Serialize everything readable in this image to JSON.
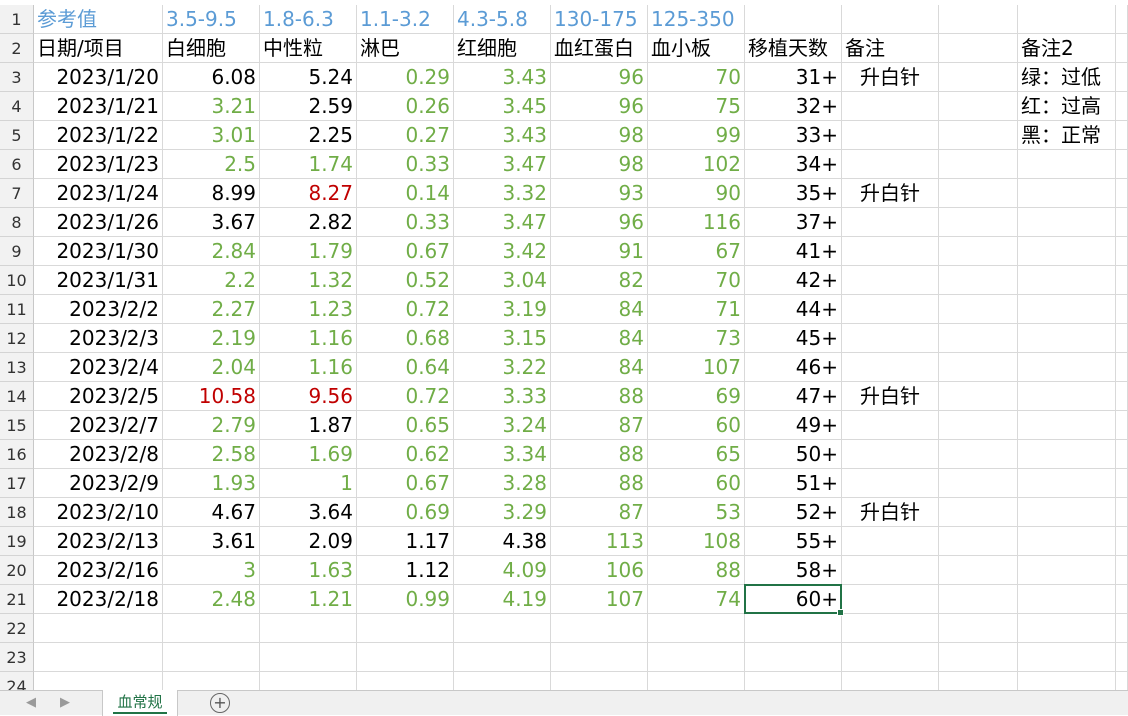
{
  "sheet": {
    "tab_name": "血常规",
    "add_sheet_icon": "plus-circle-icon",
    "selected_cell": "H21",
    "colors": {
      "ref": "#5b9bd5",
      "low": "#70ad47",
      "high": "#c00000",
      "normal": "#000000",
      "selection": "#217346"
    },
    "row_numbers": [
      "1",
      "2",
      "3",
      "4",
      "5",
      "6",
      "7",
      "8",
      "9",
      "10",
      "11",
      "12",
      "13",
      "14",
      "15",
      "16",
      "17",
      "18",
      "19",
      "20",
      "21",
      "22",
      "23",
      "24"
    ],
    "ref_row": [
      "参考值",
      "3.5-9.5",
      "1.8-6.3",
      "1.1-3.2",
      "4.3-5.8",
      "130-175",
      "125-350"
    ],
    "headers": [
      "日期/项目",
      "白细胞",
      "中性粒",
      "淋巴",
      "红细胞",
      "血红蛋白",
      "血小板",
      "移植天数",
      "备注"
    ],
    "side_notes": [
      "备注2",
      "绿：过低",
      "红：过高",
      "黑：正常"
    ],
    "rows": [
      {
        "date": "2023/1/20",
        "values": [
          "6.08",
          "5.24",
          "0.29",
          "3.43",
          "96",
          "70"
        ],
        "status": [
          "n",
          "n",
          "g",
          "g",
          "g",
          "g"
        ],
        "days": "31+",
        "note": "升白针"
      },
      {
        "date": "2023/1/21",
        "values": [
          "3.21",
          "2.59",
          "0.26",
          "3.45",
          "96",
          "75"
        ],
        "status": [
          "g",
          "n",
          "g",
          "g",
          "g",
          "g"
        ],
        "days": "32+",
        "note": ""
      },
      {
        "date": "2023/1/22",
        "values": [
          "3.01",
          "2.25",
          "0.27",
          "3.43",
          "98",
          "99"
        ],
        "status": [
          "g",
          "n",
          "g",
          "g",
          "g",
          "g"
        ],
        "days": "33+",
        "note": ""
      },
      {
        "date": "2023/1/23",
        "values": [
          "2.5",
          "1.74",
          "0.33",
          "3.47",
          "98",
          "102"
        ],
        "status": [
          "g",
          "g",
          "g",
          "g",
          "g",
          "g"
        ],
        "days": "34+",
        "note": ""
      },
      {
        "date": "2023/1/24",
        "values": [
          "8.99",
          "8.27",
          "0.14",
          "3.32",
          "93",
          "90"
        ],
        "status": [
          "n",
          "r",
          "g",
          "g",
          "g",
          "g"
        ],
        "days": "35+",
        "note": "升白针"
      },
      {
        "date": "2023/1/26",
        "values": [
          "3.67",
          "2.82",
          "0.33",
          "3.47",
          "96",
          "116"
        ],
        "status": [
          "n",
          "n",
          "g",
          "g",
          "g",
          "g"
        ],
        "days": "37+",
        "note": ""
      },
      {
        "date": "2023/1/30",
        "values": [
          "2.84",
          "1.79",
          "0.67",
          "3.42",
          "91",
          "67"
        ],
        "status": [
          "g",
          "g",
          "g",
          "g",
          "g",
          "g"
        ],
        "days": "41+",
        "note": ""
      },
      {
        "date": "2023/1/31",
        "values": [
          "2.2",
          "1.32",
          "0.52",
          "3.04",
          "82",
          "70"
        ],
        "status": [
          "g",
          "g",
          "g",
          "g",
          "g",
          "g"
        ],
        "days": "42+",
        "note": ""
      },
      {
        "date": "2023/2/2",
        "values": [
          "2.27",
          "1.23",
          "0.72",
          "3.19",
          "84",
          "71"
        ],
        "status": [
          "g",
          "g",
          "g",
          "g",
          "g",
          "g"
        ],
        "days": "44+",
        "note": ""
      },
      {
        "date": "2023/2/3",
        "values": [
          "2.19",
          "1.16",
          "0.68",
          "3.15",
          "84",
          "73"
        ],
        "status": [
          "g",
          "g",
          "g",
          "g",
          "g",
          "g"
        ],
        "days": "45+",
        "note": ""
      },
      {
        "date": "2023/2/4",
        "values": [
          "2.04",
          "1.16",
          "0.64",
          "3.22",
          "84",
          "107"
        ],
        "status": [
          "g",
          "g",
          "g",
          "g",
          "g",
          "g"
        ],
        "days": "46+",
        "note": ""
      },
      {
        "date": "2023/2/5",
        "values": [
          "10.58",
          "9.56",
          "0.72",
          "3.33",
          "88",
          "69"
        ],
        "status": [
          "r",
          "r",
          "g",
          "g",
          "g",
          "g"
        ],
        "days": "47+",
        "note": "升白针"
      },
      {
        "date": "2023/2/7",
        "values": [
          "2.79",
          "1.87",
          "0.65",
          "3.24",
          "87",
          "60"
        ],
        "status": [
          "g",
          "n",
          "g",
          "g",
          "g",
          "g"
        ],
        "days": "49+",
        "note": ""
      },
      {
        "date": "2023/2/8",
        "values": [
          "2.58",
          "1.69",
          "0.62",
          "3.34",
          "88",
          "65"
        ],
        "status": [
          "g",
          "g",
          "g",
          "g",
          "g",
          "g"
        ],
        "days": "50+",
        "note": ""
      },
      {
        "date": "2023/2/9",
        "values": [
          "1.93",
          "1",
          "0.67",
          "3.28",
          "88",
          "60"
        ],
        "status": [
          "g",
          "g",
          "g",
          "g",
          "g",
          "g"
        ],
        "days": "51+",
        "note": ""
      },
      {
        "date": "2023/2/10",
        "values": [
          "4.67",
          "3.64",
          "0.69",
          "3.29",
          "87",
          "53"
        ],
        "status": [
          "n",
          "n",
          "g",
          "g",
          "g",
          "g"
        ],
        "days": "52+",
        "note": "升白针"
      },
      {
        "date": "2023/2/13",
        "values": [
          "3.61",
          "2.09",
          "1.17",
          "4.38",
          "113",
          "108"
        ],
        "status": [
          "n",
          "n",
          "n",
          "n",
          "g",
          "g"
        ],
        "days": "55+",
        "note": ""
      },
      {
        "date": "2023/2/16",
        "values": [
          "3",
          "1.63",
          "1.12",
          "4.09",
          "106",
          "88"
        ],
        "status": [
          "g",
          "g",
          "n",
          "g",
          "g",
          "g"
        ],
        "days": "58+",
        "note": ""
      },
      {
        "date": "2023/2/18",
        "values": [
          "2.48",
          "1.21",
          "0.99",
          "4.19",
          "107",
          "74"
        ],
        "status": [
          "g",
          "g",
          "g",
          "g",
          "g",
          "g"
        ],
        "days": "60+",
        "note": ""
      }
    ]
  }
}
